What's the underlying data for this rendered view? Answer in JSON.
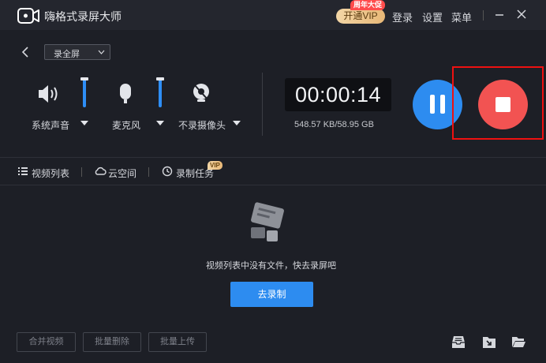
{
  "titlebar": {
    "app_title": "嗨格式录屏大师",
    "vip_button": "开通VIP",
    "vip_promo": "周年大促",
    "login": "登录",
    "settings": "设置",
    "menu": "菜单"
  },
  "controls": {
    "mode_select": "录全屏",
    "devices": [
      {
        "label": "系统声音",
        "icon": "speaker-icon"
      },
      {
        "label": "麦克风",
        "icon": "microphone-icon"
      },
      {
        "label": "不录摄像头",
        "icon": "camera-off-icon"
      }
    ],
    "timer": "00:00:14",
    "storage": "548.57 KB/58.95 GB"
  },
  "tabs": [
    {
      "label": "视频列表",
      "icon": "list-icon"
    },
    {
      "label": "云空间",
      "icon": "cloud-icon"
    },
    {
      "label": "录制任务",
      "icon": "clock-icon"
    }
  ],
  "tabs_vip_tag": "VIP",
  "empty_state": {
    "message": "视频列表中没有文件，快去录屏吧",
    "button": "去录制"
  },
  "bottom": {
    "merge": "合并视频",
    "batch_delete": "批量删除",
    "batch_upload": "批量上传"
  },
  "colors": {
    "accent": "#2d8cf0",
    "stop": "#f25352",
    "highlight": "#ee1111",
    "background": "#1d1f26"
  }
}
